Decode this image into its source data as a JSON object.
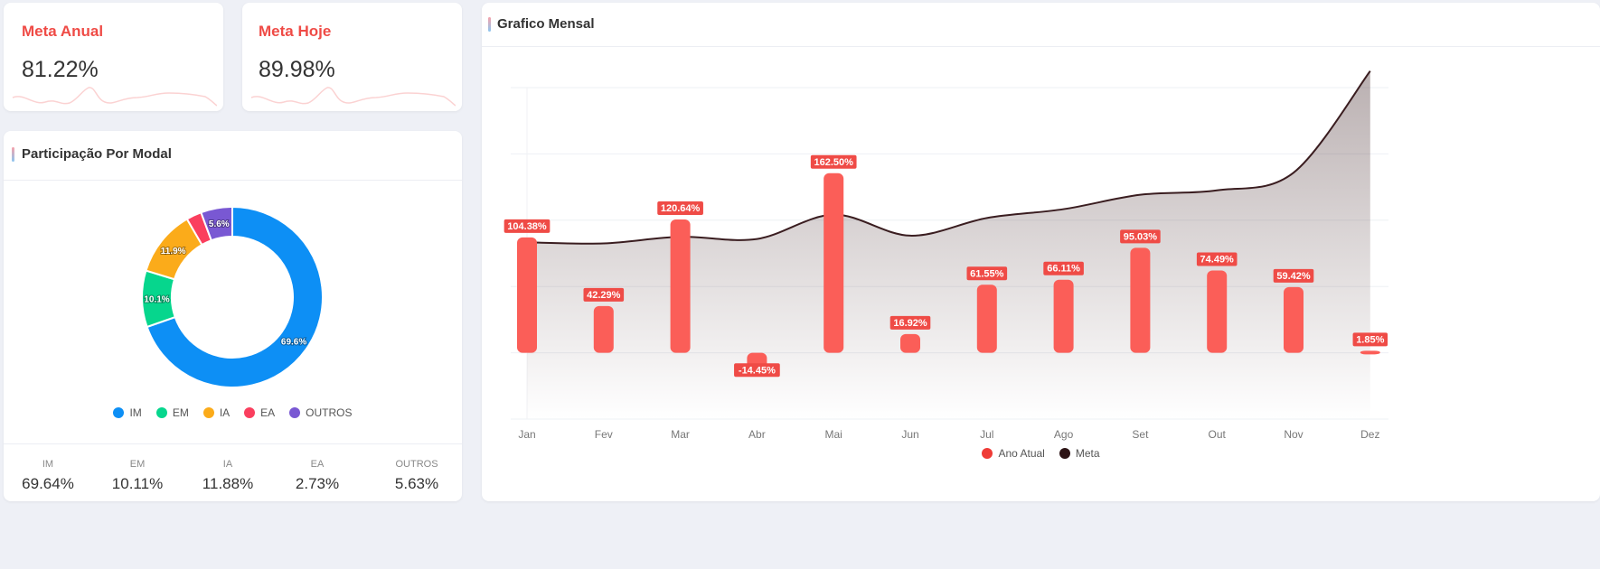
{
  "kpis": {
    "annual": {
      "title": "Meta Anual",
      "value": "81.22%"
    },
    "today": {
      "title": "Meta Hoje",
      "value": "89.98%"
    }
  },
  "pie_card": {
    "title": "Participação Por Modal",
    "stats": [
      {
        "label": "IM",
        "value": "69.64%"
      },
      {
        "label": "EM",
        "value": "10.11%"
      },
      {
        "label": "IA",
        "value": "11.88%"
      },
      {
        "label": "EA",
        "value": "2.73%"
      },
      {
        "label": "OUTROS",
        "value": "5.63%"
      }
    ]
  },
  "bar_card": {
    "title": "Grafico Mensal"
  },
  "colors": {
    "kpi_title": "#ef4b46",
    "bar": "#fb5e58",
    "bar_label_bg": "#ef4b46",
    "line": "#3a1d20",
    "legend_bar": "#ef3b36",
    "legend_line": "#2d1416"
  },
  "chart_data": [
    {
      "type": "pie",
      "donut": true,
      "labels": [
        "IM",
        "EM",
        "IA",
        "EA",
        "OUTROS"
      ],
      "values": [
        69.64,
        10.11,
        11.88,
        2.73,
        5.63
      ],
      "data_labels": [
        "69.6%",
        "10.1%",
        "11.9%",
        "",
        "5.6%"
      ],
      "colors": [
        "#0d8ff5",
        "#06d68d",
        "#fbab1a",
        "#fa3f5e",
        "#7958d3"
      ],
      "legend_position": "bottom"
    },
    {
      "type": "bar",
      "categories": [
        "Jan",
        "Fev",
        "Mar",
        "Abr",
        "Mai",
        "Jun",
        "Jul",
        "Ago",
        "Set",
        "Out",
        "Nov",
        "Dez"
      ],
      "series": [
        {
          "name": "Ano Atual",
          "type": "bar",
          "values": [
            104.38,
            42.29,
            120.64,
            -14.45,
            162.5,
            16.92,
            61.55,
            66.11,
            95.03,
            74.49,
            59.42,
            1.85
          ],
          "data_labels": [
            "104.38%",
            "42.29%",
            "120.64%",
            "-14.45%",
            "162.50%",
            "16.92%",
            "61.55%",
            "66.11%",
            "95.03%",
            "74.49%",
            "59.42%",
            "1.85%"
          ]
        },
        {
          "name": "Meta",
          "type": "area",
          "values": [
            100,
            99,
            105,
            103,
            125,
            106,
            122,
            130,
            143,
            147,
            163,
            255
          ]
        }
      ],
      "ylim": [
        -60,
        240
      ],
      "grid": true,
      "legend_position": "bottom"
    }
  ]
}
